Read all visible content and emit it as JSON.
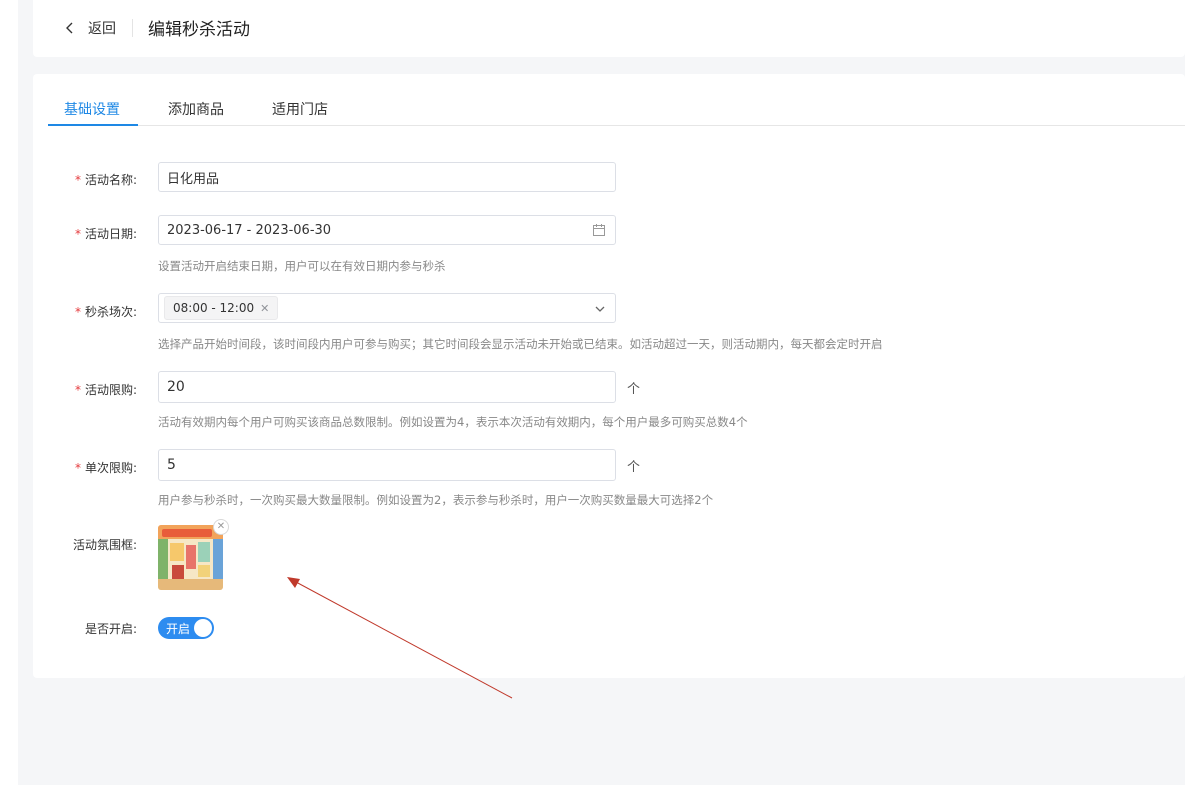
{
  "header": {
    "back_label": "返回",
    "title": "编辑秒杀活动"
  },
  "tabs": [
    {
      "label": "基础设置",
      "active": true
    },
    {
      "label": "添加商品",
      "active": false
    },
    {
      "label": "适用门店",
      "active": false
    }
  ],
  "form": {
    "required_mark": "*",
    "name": {
      "label": "活动名称:",
      "value": "日化用品"
    },
    "date": {
      "label": "活动日期:",
      "value": "2023-06-17 - 2023-06-30",
      "hint": "设置活动开启结束日期，用户可以在有效日期内参与秒杀"
    },
    "session": {
      "label": "秒杀场次:",
      "tag": "08:00 - 12:00",
      "hint": "选择产品开始时间段，该时间段内用户可参与购买；其它时间段会显示活动未开始或已结束。如活动超过一天，则活动期内，每天都会定时开启"
    },
    "total_limit": {
      "label": "活动限购:",
      "value": "20",
      "unit": "个",
      "hint": "活动有效期内每个用户可购买该商品总数限制。例如设置为4，表示本次活动有效期内，每个用户最多可购买总数4个"
    },
    "single_limit": {
      "label": "单次限购:",
      "value": "5",
      "unit": "个",
      "hint": "用户参与秒杀时，一次购买最大数量限制。例如设置为2，表示参与秒杀时，用户一次购买数量最大可选择2个"
    },
    "frame": {
      "label": "活动氛围框:"
    },
    "enabled": {
      "label": "是否开启:",
      "switch_text": "开启",
      "on": true
    }
  },
  "colors": {
    "accent": "#1e88e5",
    "required": "#e4393c",
    "annotation_arrow": "#c0392b"
  },
  "icons": [
    "chevron-left-icon",
    "calendar-icon",
    "chevron-down-icon",
    "close-icon"
  ]
}
